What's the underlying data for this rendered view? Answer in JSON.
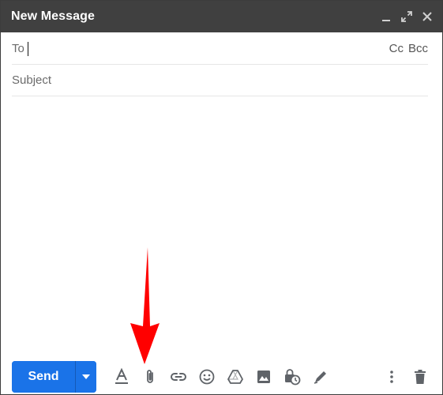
{
  "window": {
    "title": "New Message",
    "controls": [
      "minimize-icon",
      "expand-icon",
      "close-icon"
    ]
  },
  "to": {
    "label": "To",
    "value": "",
    "cc_label": "Cc",
    "bcc_label": "Bcc"
  },
  "subject": {
    "placeholder": "Subject"
  },
  "toolbar": {
    "send_label": "Send",
    "icons": [
      "formatting-icon",
      "attach-icon",
      "link-icon",
      "emoji-icon",
      "drive-icon",
      "image-icon",
      "confidential-icon",
      "signature-icon"
    ],
    "right_icons": [
      "more-options-icon",
      "trash-icon"
    ]
  },
  "colors": {
    "titlebar": "#404040",
    "send": "#1a73e8",
    "icon": "#5f6368",
    "annotation_arrow": "#ff0000"
  }
}
